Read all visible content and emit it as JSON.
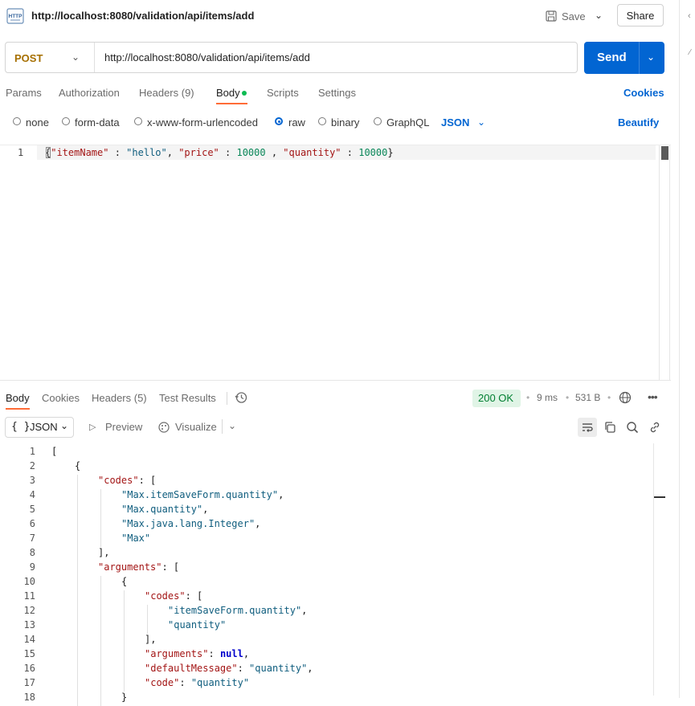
{
  "header": {
    "title": "http://localhost:8080/validation/api/items/add",
    "save_label": "Save",
    "share_label": "Share"
  },
  "request": {
    "method": "POST",
    "url": "http://localhost:8080/validation/api/items/add",
    "send_label": "Send",
    "tabs": [
      "Params",
      "Authorization",
      "Headers (9)",
      "Body",
      "Scripts",
      "Settings"
    ],
    "active_tab": "Body",
    "cookies_label": "Cookies",
    "body_types": [
      "none",
      "form-data",
      "x-www-form-urlencoded",
      "raw",
      "binary",
      "GraphQL"
    ],
    "selected_body_type": "raw",
    "format": "JSON",
    "beautify_label": "Beautify",
    "editor": {
      "line_number": "1",
      "tokens": [
        {
          "t": "{",
          "c": "p"
        },
        {
          "t": "\"itemName\"",
          "c": "k"
        },
        {
          "t": " : ",
          "c": "p"
        },
        {
          "t": "\"hello\"",
          "c": "s"
        },
        {
          "t": ", ",
          "c": "p"
        },
        {
          "t": "\"price\"",
          "c": "k"
        },
        {
          "t": " : ",
          "c": "p"
        },
        {
          "t": "10000",
          "c": "n"
        },
        {
          "t": " , ",
          "c": "p"
        },
        {
          "t": "\"quantity\"",
          "c": "k"
        },
        {
          "t": " : ",
          "c": "p"
        },
        {
          "t": "10000",
          "c": "n"
        },
        {
          "t": "}",
          "c": "p"
        }
      ]
    }
  },
  "response": {
    "tabs": [
      "Body",
      "Cookies",
      "Headers (5)",
      "Test Results"
    ],
    "active_tab": "Body",
    "status": "200 OK",
    "time": "9 ms",
    "size": "531 B",
    "format_icon": "{ }",
    "format": "JSON",
    "preview_label": "Preview",
    "visualize_label": "Visualize",
    "lines": [
      {
        "n": "1",
        "i": 0,
        "tokens": [
          {
            "t": "[",
            "c": "p"
          }
        ]
      },
      {
        "n": "2",
        "i": 1,
        "tokens": [
          {
            "t": "{",
            "c": "p"
          }
        ]
      },
      {
        "n": "3",
        "i": 2,
        "tokens": [
          {
            "t": "\"codes\"",
            "c": "k"
          },
          {
            "t": ": [",
            "c": "p"
          }
        ]
      },
      {
        "n": "4",
        "i": 3,
        "tokens": [
          {
            "t": "\"Max.itemSaveForm.quantity\"",
            "c": "s"
          },
          {
            "t": ",",
            "c": "p"
          }
        ]
      },
      {
        "n": "5",
        "i": 3,
        "tokens": [
          {
            "t": "\"Max.quantity\"",
            "c": "s"
          },
          {
            "t": ",",
            "c": "p"
          }
        ]
      },
      {
        "n": "6",
        "i": 3,
        "tokens": [
          {
            "t": "\"Max.java.lang.Integer\"",
            "c": "s"
          },
          {
            "t": ",",
            "c": "p"
          }
        ]
      },
      {
        "n": "7",
        "i": 3,
        "tokens": [
          {
            "t": "\"Max\"",
            "c": "s"
          }
        ]
      },
      {
        "n": "8",
        "i": 2,
        "tokens": [
          {
            "t": "],",
            "c": "p"
          }
        ]
      },
      {
        "n": "9",
        "i": 2,
        "tokens": [
          {
            "t": "\"arguments\"",
            "c": "k"
          },
          {
            "t": ": [",
            "c": "p"
          }
        ]
      },
      {
        "n": "10",
        "i": 3,
        "tokens": [
          {
            "t": "{",
            "c": "p"
          }
        ]
      },
      {
        "n": "11",
        "i": 4,
        "tokens": [
          {
            "t": "\"codes\"",
            "c": "k"
          },
          {
            "t": ": [",
            "c": "p"
          }
        ]
      },
      {
        "n": "12",
        "i": 5,
        "tokens": [
          {
            "t": "\"itemSaveForm.quantity\"",
            "c": "s"
          },
          {
            "t": ",",
            "c": "p"
          }
        ]
      },
      {
        "n": "13",
        "i": 5,
        "tokens": [
          {
            "t": "\"quantity\"",
            "c": "s"
          }
        ]
      },
      {
        "n": "14",
        "i": 4,
        "tokens": [
          {
            "t": "],",
            "c": "p"
          }
        ]
      },
      {
        "n": "15",
        "i": 4,
        "tokens": [
          {
            "t": "\"arguments\"",
            "c": "k"
          },
          {
            "t": ": ",
            "c": "p"
          },
          {
            "t": "null",
            "c": "kw"
          },
          {
            "t": ",",
            "c": "p"
          }
        ]
      },
      {
        "n": "16",
        "i": 4,
        "tokens": [
          {
            "t": "\"defaultMessage\"",
            "c": "k"
          },
          {
            "t": ": ",
            "c": "p"
          },
          {
            "t": "\"quantity\"",
            "c": "s"
          },
          {
            "t": ",",
            "c": "p"
          }
        ]
      },
      {
        "n": "17",
        "i": 4,
        "tokens": [
          {
            "t": "\"code\"",
            "c": "k"
          },
          {
            "t": ": ",
            "c": "p"
          },
          {
            "t": "\"quantity\"",
            "c": "s"
          }
        ]
      },
      {
        "n": "18",
        "i": 3,
        "tokens": [
          {
            "t": "}",
            "c": "p"
          }
        ]
      }
    ]
  }
}
